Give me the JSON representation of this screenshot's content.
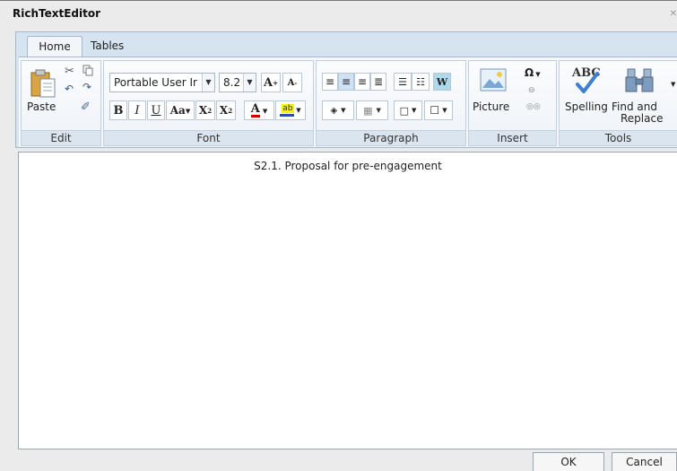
{
  "window": {
    "title": "RichTextEditor"
  },
  "tabs": [
    {
      "label": "Home"
    },
    {
      "label": "Tables"
    }
  ],
  "groups": {
    "edit": {
      "label": "Edit",
      "paste_label": "Paste"
    },
    "font": {
      "label": "Font",
      "font_family": "Portable User Ir",
      "font_size": "8.2",
      "grow_label": "A",
      "shrink_label": "A",
      "bold": "B",
      "italic": "I",
      "underline": "U",
      "change_case": "Aa",
      "superscript": "X",
      "subscript": "X",
      "font_color": "A"
    },
    "paragraph": {
      "label": "Paragraph",
      "show_marks": "W"
    },
    "insert": {
      "label": "Insert",
      "picture_label": "Picture",
      "symbol_label": "Ω"
    },
    "tools": {
      "label": "Tools",
      "spelling_label": "Spelling",
      "find_replace_line1": "Find and",
      "find_replace_line2": "Replace",
      "abc": "ABC"
    }
  },
  "editor": {
    "content": "S2.1. Proposal for pre-engagement"
  },
  "dialog": {
    "ok_label": "OK",
    "cancel_label": "Cancel"
  }
}
